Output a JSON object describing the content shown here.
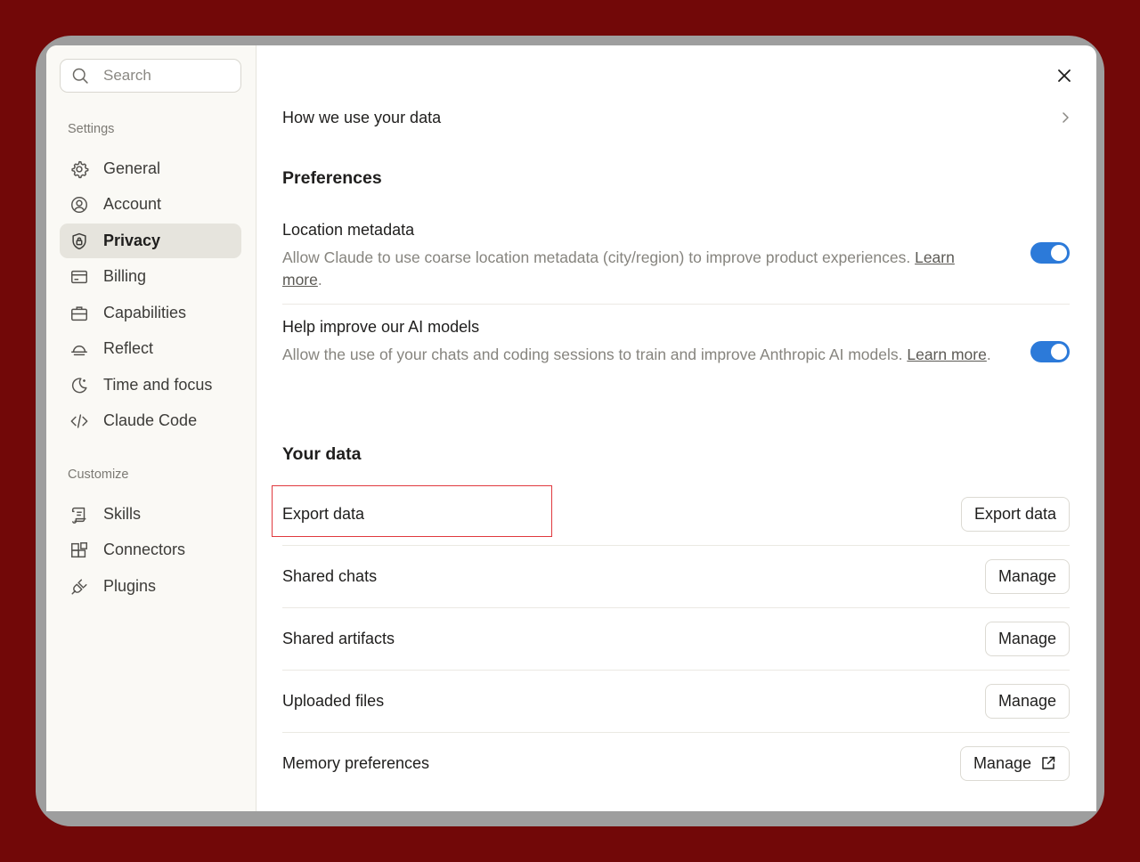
{
  "sidebar": {
    "search_placeholder": "Search",
    "settings_label": "Settings",
    "settings_items": [
      {
        "label": "General",
        "icon": "gear-icon"
      },
      {
        "label": "Account",
        "icon": "user-circle-icon"
      },
      {
        "label": "Privacy",
        "icon": "shield-lock-icon",
        "active": true
      },
      {
        "label": "Billing",
        "icon": "credit-card-icon"
      },
      {
        "label": "Capabilities",
        "icon": "briefcase-icon"
      },
      {
        "label": "Reflect",
        "icon": "bell-icon"
      },
      {
        "label": "Time and focus",
        "icon": "moon-icon"
      },
      {
        "label": "Claude Code",
        "icon": "code-icon"
      }
    ],
    "customize_label": "Customize",
    "customize_items": [
      {
        "label": "Skills",
        "icon": "scroll-icon"
      },
      {
        "label": "Connectors",
        "icon": "blocks-icon"
      },
      {
        "label": "Plugins",
        "icon": "plug-icon"
      }
    ]
  },
  "main": {
    "how_we_use": "How we use your data",
    "preferences_heading": "Preferences",
    "location": {
      "title": "Location metadata",
      "desc": "Allow Claude to use coarse location metadata (city/region) to improve product experiences. ",
      "learn": "Learn more",
      "enabled": true
    },
    "improve": {
      "title": "Help improve our AI models",
      "desc": "Allow the use of your chats and coding sessions to train and improve Anthropic AI models. ",
      "learn": "Learn more",
      "enabled": true
    },
    "your_data_heading": "Your data",
    "rows": [
      {
        "label": "Export data",
        "button": "Export data"
      },
      {
        "label": "Shared chats",
        "button": "Manage"
      },
      {
        "label": "Shared artifacts",
        "button": "Manage"
      },
      {
        "label": "Uploaded files",
        "button": "Manage"
      },
      {
        "label": "Memory preferences",
        "button": "Manage",
        "external": true
      }
    ]
  },
  "colors": {
    "background": "#720808",
    "toggle_on": "#2c7ad9",
    "highlight": "#e0393e"
  }
}
